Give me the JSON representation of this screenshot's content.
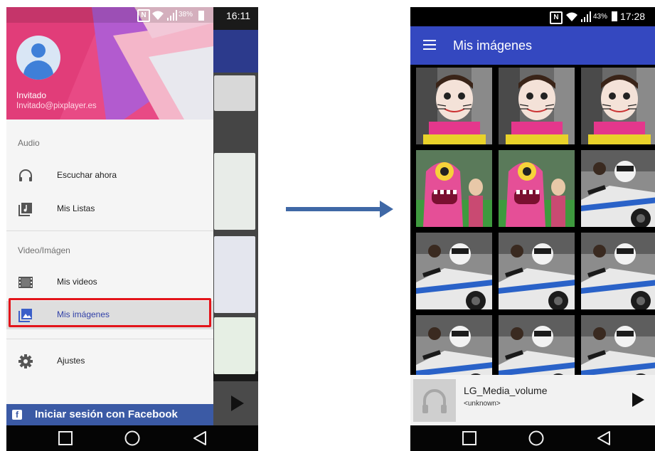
{
  "left_screen": {
    "status": {
      "battery_pct": "38%",
      "time": "16:11"
    },
    "user": {
      "name": "Invitado",
      "email": "Invitado@pixplayer.es"
    },
    "sections": {
      "audio": "Audio",
      "video_image": "Video/Imágen"
    },
    "menu": {
      "listen_now": "Escuchar ahora",
      "my_lists": "Mis Listas",
      "my_videos": "Mis videos",
      "my_images": "Mis imágenes",
      "settings": "Ajustes"
    },
    "facebook_login": "Iniciar sesión con Facebook",
    "facebook_icon": "f"
  },
  "right_screen": {
    "status": {
      "battery_pct": "43%",
      "time": "17:28"
    },
    "title": "Mis imágenes",
    "grid": {
      "rows": 4,
      "columns": 3,
      "photo_subjects": [
        "face-painted-girl",
        "face-painted-girl",
        "face-painted-girl",
        "pink-monster-costume",
        "pink-monster-costume",
        "police-motorcycle",
        "police-motorcycle",
        "police-motorcycle",
        "police-motorcycle",
        "police-motorcycle",
        "police-motorcycle",
        "police-motorcycle"
      ]
    },
    "player": {
      "title": "LG_Media_volume",
      "artist": "<unknown>"
    }
  },
  "colors": {
    "app_bar": "#3448c0",
    "drawer_selected_text": "#3141a8",
    "highlight": "#e3141a",
    "facebook": "#3b5aa5",
    "arrow": "#3f68a6"
  }
}
